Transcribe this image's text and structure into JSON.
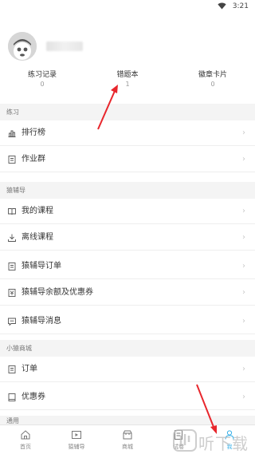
{
  "status_bar": {
    "time": "3:21"
  },
  "stats": [
    {
      "label": "练习记录",
      "count": "0"
    },
    {
      "label": "错题本",
      "count": "1"
    },
    {
      "label": "徽章卡片",
      "count": "0"
    }
  ],
  "sections": {
    "practice": {
      "title": "练习",
      "items": [
        {
          "label": "排行榜",
          "icon": "leaderboard-icon"
        },
        {
          "label": "作业群",
          "icon": "homework-group-icon"
        }
      ]
    },
    "tutoring": {
      "title": "猿辅导",
      "items": [
        {
          "label": "我的课程",
          "icon": "book-icon"
        },
        {
          "label": "离线课程",
          "icon": "download-icon"
        },
        {
          "label": "猿辅导订单",
          "icon": "order-icon"
        },
        {
          "label": "猿辅导余额及优惠券",
          "icon": "wallet-icon"
        },
        {
          "label": "猿辅导消息",
          "icon": "message-icon"
        }
      ]
    },
    "mall": {
      "title": "小猿商城",
      "items": [
        {
          "label": "订单",
          "icon": "order-icon"
        },
        {
          "label": "优惠券",
          "icon": "coupon-icon"
        }
      ]
    },
    "general": {
      "title": "通用"
    }
  },
  "tabbar": [
    {
      "label": "首页",
      "icon": "home-icon"
    },
    {
      "label": "猿辅导",
      "icon": "video-icon"
    },
    {
      "label": "商城",
      "icon": "store-icon"
    },
    {
      "label": "试卷",
      "icon": "exam-icon"
    },
    {
      "label": "我",
      "icon": "profile-icon",
      "active": true
    }
  ],
  "watermark": {
    "text": "听下载"
  },
  "colors": {
    "accent": "#38b0e8",
    "annotation_arrow": "#e8262c",
    "section_bg": "#f4f4f4"
  }
}
